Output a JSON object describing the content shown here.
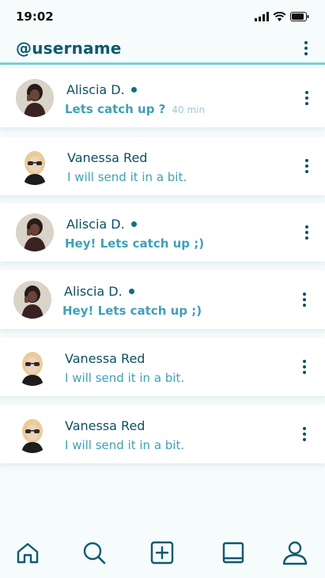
{
  "status": {
    "time": "19:02"
  },
  "header": {
    "title": "@username"
  },
  "chats": [
    {
      "name": "Aliscia D.",
      "online": true,
      "message": "Lets catch up ?",
      "time": "40 min",
      "unread": true,
      "avatar": "person-dark-hair"
    },
    {
      "name": "Vanessa Red",
      "online": false,
      "message": "I will send it in a bit.",
      "time": "",
      "unread": false,
      "avatar": "person-blonde-sunglasses"
    },
    {
      "name": "Aliscia D.",
      "online": true,
      "message": "Hey! Lets catch up ;)",
      "time": "",
      "unread": true,
      "avatar": "person-dark-hair"
    },
    {
      "name": "Aliscia D.",
      "online": true,
      "message": "Hey! Lets catch up ;)",
      "time": "",
      "unread": true,
      "avatar": "person-dark-hair"
    },
    {
      "name": "Vanessa Red",
      "online": false,
      "message": "I will send it in a bit.",
      "time": "",
      "unread": false,
      "avatar": "person-blonde-sunglasses"
    },
    {
      "name": "Vanessa Red",
      "online": false,
      "message": "I will send it in a bit.",
      "time": "",
      "unread": false,
      "avatar": "person-blonde-sunglasses"
    }
  ],
  "nav": [
    {
      "icon": "home-icon"
    },
    {
      "icon": "search-icon"
    },
    {
      "icon": "add-square-icon"
    },
    {
      "icon": "book-icon"
    },
    {
      "icon": "profile-icon"
    }
  ],
  "colors": {
    "accent": "#0d4f63",
    "message": "#3ea1b7",
    "divider": "#7fcfd2",
    "background": "#f6fbfc"
  }
}
